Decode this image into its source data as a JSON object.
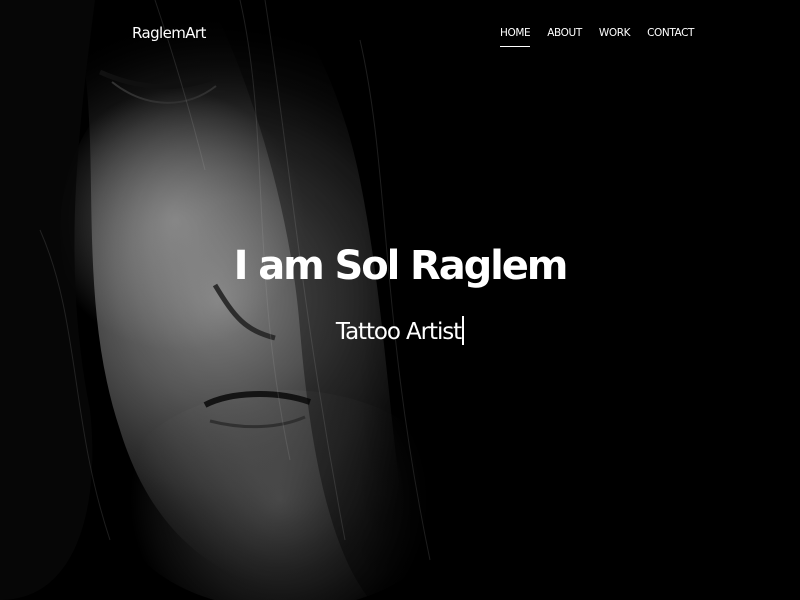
{
  "brand": {
    "name": "RaglemArt"
  },
  "nav": {
    "items": [
      {
        "label": "HOME",
        "active": true
      },
      {
        "label": "ABOUT",
        "active": false
      },
      {
        "label": "WORK",
        "active": false
      },
      {
        "label": "CONTACT",
        "active": false
      }
    ]
  },
  "hero": {
    "title": "I am Sol Raglem",
    "subtitle": "Tattoo Artist"
  },
  "colors": {
    "background": "#000000",
    "text": "#ffffff"
  }
}
